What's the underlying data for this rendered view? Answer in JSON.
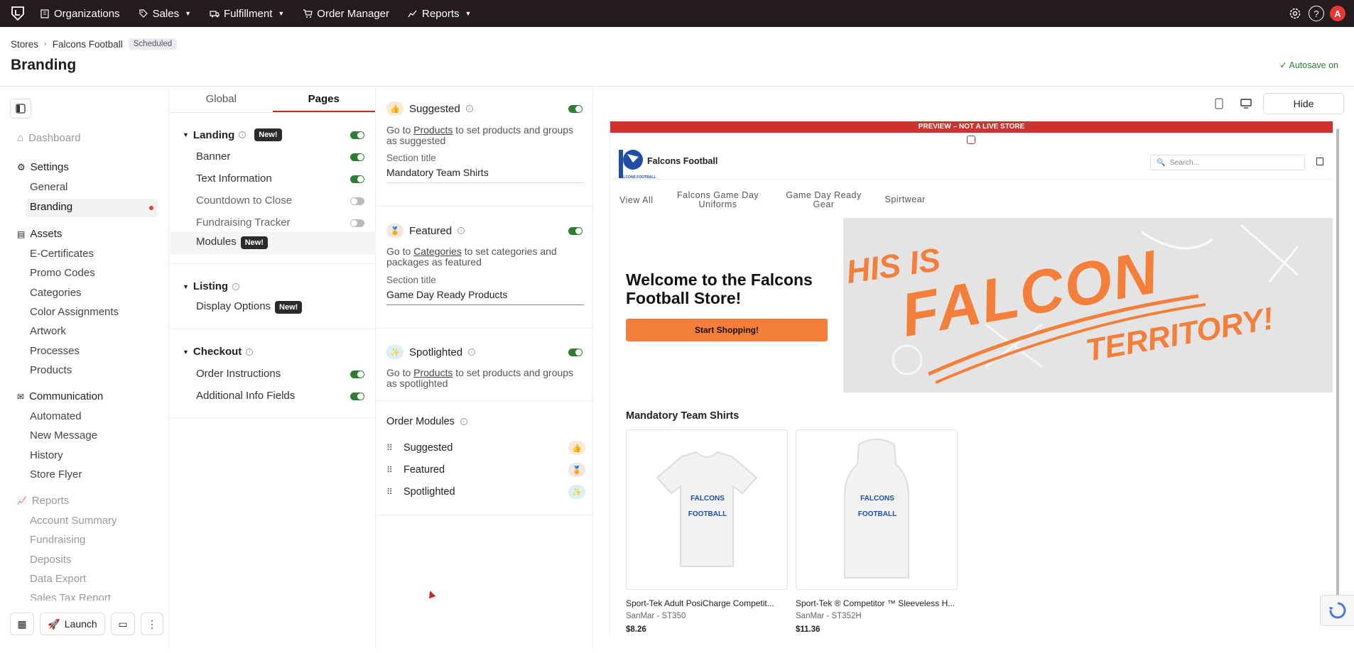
{
  "topnav": {
    "items": [
      {
        "label": "Organizations",
        "icon": "building-icon"
      },
      {
        "label": "Sales",
        "icon": "tag-icon",
        "dropdown": true
      },
      {
        "label": "Fulfillment",
        "icon": "truck-icon",
        "dropdown": true
      },
      {
        "label": "Order Manager",
        "icon": "cart-icon"
      },
      {
        "label": "Reports",
        "icon": "chart-icon",
        "dropdown": true
      }
    ],
    "avatar_letter": "A",
    "help_glyph": "?"
  },
  "header": {
    "breadcrumb": [
      "Stores",
      "Falcons Football"
    ],
    "status_badge": "Scheduled",
    "title": "Branding",
    "autosave": "Autosave on"
  },
  "sidebar": {
    "dashboard": "Dashboard",
    "settings": {
      "label": "Settings",
      "items": [
        "General",
        "Branding"
      ]
    },
    "assets": {
      "label": "Assets",
      "items": [
        "E-Certificates",
        "Promo Codes",
        "Categories",
        "Color Assignments",
        "Artwork",
        "Processes",
        "Products"
      ]
    },
    "communication": {
      "label": "Communication",
      "items": [
        "Automated",
        "New Message",
        "History",
        "Store Flyer"
      ]
    },
    "reports": {
      "label": "Reports",
      "items": [
        "Account Summary",
        "Fundraising",
        "Deposits",
        "Data Export",
        "Sales Tax Report"
      ]
    },
    "launch": "Launch"
  },
  "pages_panel": {
    "tabs": [
      "Global",
      "Pages"
    ],
    "active_tab": "Pages",
    "new_badge": "New!",
    "landing": {
      "label": "Landing",
      "items": [
        {
          "label": "Banner",
          "on": true
        },
        {
          "label": "Text Information",
          "on": true
        },
        {
          "label": "Countdown to Close",
          "on": false
        },
        {
          "label": "Fundraising Tracker",
          "on": false
        },
        {
          "label": "Modules"
        }
      ]
    },
    "listing": {
      "label": "Listing",
      "items": [
        "Display Options"
      ]
    },
    "checkout": {
      "label": "Checkout",
      "items": [
        {
          "label": "Order Instructions",
          "on": true
        },
        {
          "label": "Additional Info Fields",
          "on": true
        }
      ]
    }
  },
  "modules": {
    "suggested": {
      "title": "Suggested",
      "desc_pre": "Go to",
      "link": "Products",
      "desc_post": "to set products and groups as suggested",
      "section_label": "Section title",
      "section_value": "Mandatory Team Shirts"
    },
    "featured": {
      "title": "Featured",
      "desc_pre": "Go to",
      "link": "Categories",
      "desc_post": "to set categories and packages as featured",
      "section_label": "Section title",
      "section_value": "Game Day Ready Products"
    },
    "spotlighted": {
      "title": "Spotlighted",
      "desc_pre": "Go to",
      "link": "Products",
      "desc_post": "to set products and groups as spotlighted"
    },
    "order_title": "Order Modules",
    "order": [
      "Suggested",
      "Featured",
      "Spotlighted"
    ]
  },
  "preview": {
    "hide": "Hide",
    "banner": "PREVIEW – NOT A LIVE STORE",
    "store_name": "Falcons Football",
    "logo_text": "FALCONS FOOTBALL",
    "search_placeholder": "Search...",
    "nav": [
      "View All",
      "Falcons Game Day Uniforms",
      "Game Day Ready Gear",
      "Spirtwear"
    ],
    "hero_title": "Welcome to the Falcons Football Store!",
    "hero_button": "Start Shopping!",
    "hero_image_text": {
      "line1": "HIS IS",
      "line2": "FALCON",
      "line3": "TERRITORY!"
    },
    "section_title": "Mandatory Team Shirts",
    "products": [
      {
        "name": "Sport-Tek Adult PosiCharge Competit...",
        "sku": "SanMar - ST350",
        "price": "$8.26",
        "print": "FALCONS FOOTBALL"
      },
      {
        "name": "Sport-Tek ® Competitor ™ Sleeveless H...",
        "sku": "SanMar - ST352H",
        "price": "$11.36",
        "print": "FALCONS FOOTBALL"
      }
    ]
  },
  "colors": {
    "topbar": "#231b1d",
    "accent": "#c62828",
    "toggle_on": "#2e7d32",
    "hero_orange": "#f47f3a",
    "preview_banner": "#d32f2f"
  }
}
